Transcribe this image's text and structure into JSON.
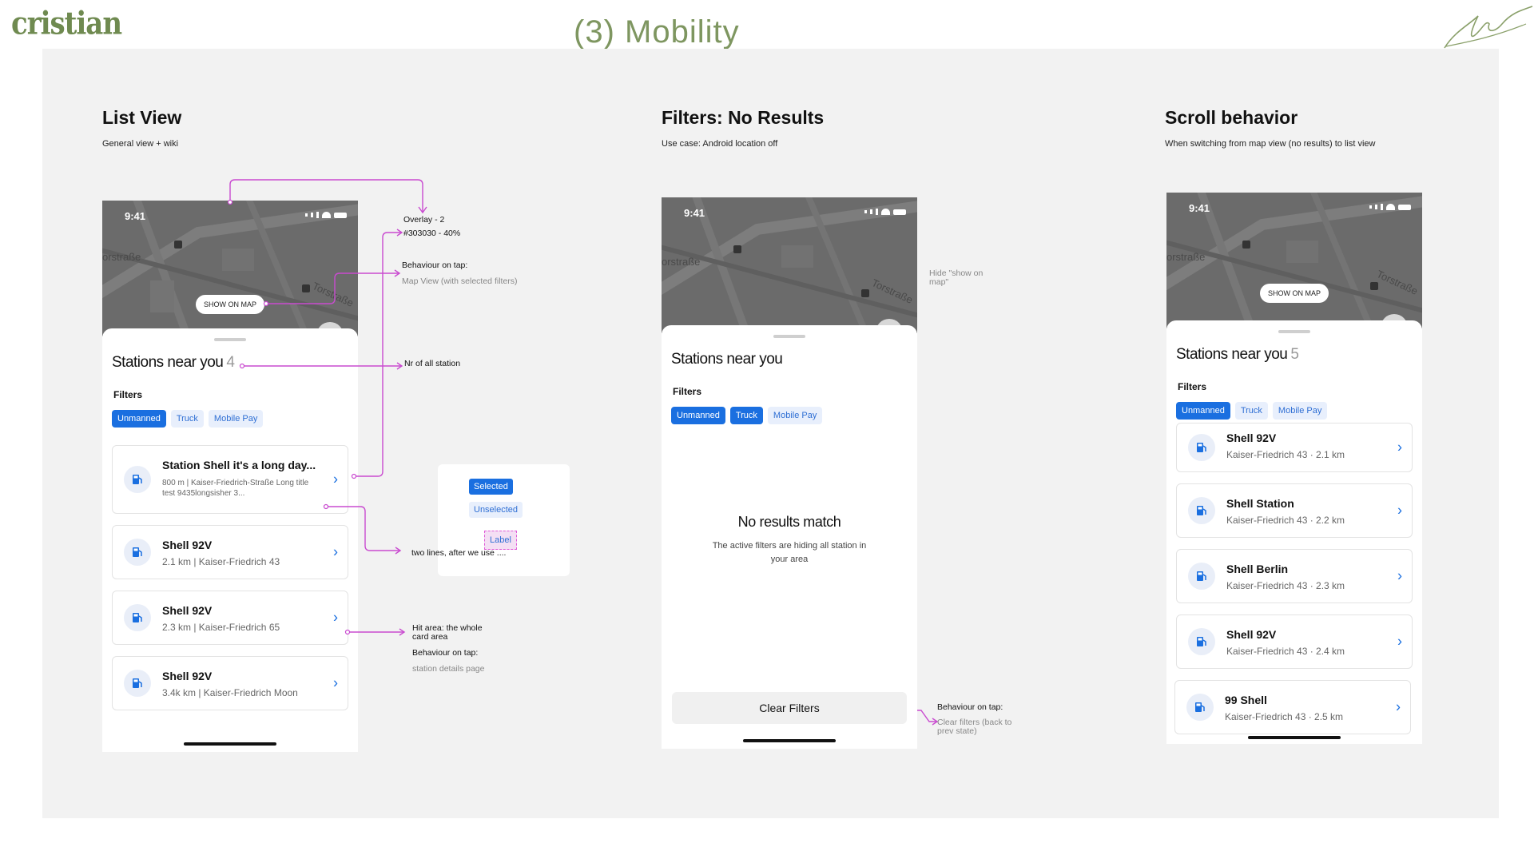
{
  "brand": {
    "logo": "cristian",
    "page_title": "(3) Mobility"
  },
  "colors": {
    "accent_blue": "#1a6fe0",
    "chip_bg": "#e8effc",
    "annotation_pink": "#c94bd0",
    "brand_green": "#7e9660"
  },
  "sections": {
    "list_view": {
      "title": "List View",
      "subtitle": "General view + wiki"
    },
    "no_results": {
      "title": "Filters: No Results",
      "subtitle": "Use case: Android location off"
    },
    "scroll": {
      "title": "Scroll behavior",
      "subtitle": "When switching from map view (no results) to list view"
    }
  },
  "phone_common": {
    "time": "9:41",
    "show_on_map": "SHOW ON MAP",
    "sheet_title": "Stations near you",
    "filters_label": "Filters",
    "chips": [
      "Unmanned",
      "Truck",
      "Mobile Pay"
    ]
  },
  "list_phone": {
    "count": "4",
    "cards": [
      {
        "title": "Station Shell it's a long day...",
        "subtitle": "800 m | Kaiser-Friedrich-Straße Long title test  9435longsisher 3..."
      },
      {
        "title": "Shell 92V",
        "subtitle": "2.1 km | Kaiser-Friedrich 43"
      },
      {
        "title": "Shell 92V",
        "subtitle": "2.3 km | Kaiser-Friedrich 65"
      },
      {
        "title": "Shell 92V",
        "subtitle": "3.4k km | Kaiser-Friedrich Moon"
      }
    ]
  },
  "annotations": {
    "overlay": "Overlay - 2",
    "overlay_color": "#303030 - 40%",
    "tap_map_title": "Behaviour on tap:",
    "tap_map_text": "Map View (with selected filters)",
    "nr_stations": "Nr of all station",
    "legend_selected": "Selected",
    "legend_unselected": "Unselected",
    "legend_label": "Label",
    "two_lines": "two lines, after we use ....",
    "hit_area": "Hit area: the whole card area",
    "tap_card_title": "Behaviour on tap:",
    "tap_card_text": "station details page",
    "hide_show_on_map": "Hide \"show on map\"",
    "tap_clear_title": "Behaviour on tap:",
    "tap_clear_text": "Clear filters (back to prev state)"
  },
  "no_results_phone": {
    "empty_title": "No results match",
    "empty_text": "The active filters are hiding all station in your area",
    "clear_button": "Clear Filters"
  },
  "scroll_phone": {
    "count": "5",
    "cards": [
      {
        "title": "Shell 92V",
        "subtitle": "Kaiser-Friedrich 43 · 2.1 km"
      },
      {
        "title": "Shell Station",
        "subtitle": "Kaiser-Friedrich 43 · 2.2 km"
      },
      {
        "title": "Shell Berlin",
        "subtitle": "Kaiser-Friedrich 43 · 2.3 km"
      },
      {
        "title": "Shell 92V",
        "subtitle": "Kaiser-Friedrich 43 · 2.4 km"
      },
      {
        "title": "99 Shell",
        "subtitle": "Kaiser-Friedrich 43 · 2.5 km"
      }
    ]
  }
}
